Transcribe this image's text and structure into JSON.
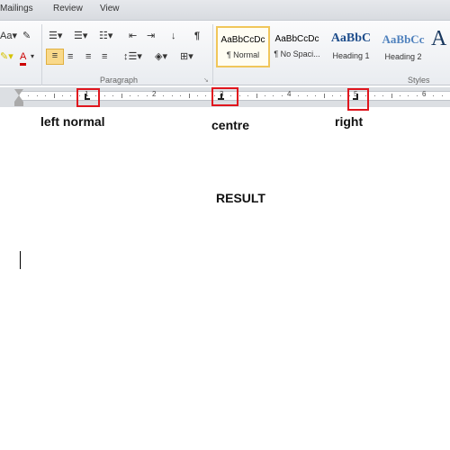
{
  "tabs": [
    "Mailings",
    "Review",
    "View"
  ],
  "ribbon": {
    "paragraph_group": "Paragraph",
    "styles_group": "Styles",
    "styles": [
      {
        "preview": "AaBbCcDc",
        "label": "¶ Normal",
        "selected": true
      },
      {
        "preview": "AaBbCcDc",
        "label": "¶ No Spaci...",
        "selected": false
      },
      {
        "preview": "AaBbC",
        "label": "Heading 1",
        "selected": false
      },
      {
        "preview": "AaBbCc",
        "label": "Heading 2",
        "selected": false
      },
      {
        "preview": "A",
        "label": "",
        "selected": false
      }
    ],
    "pilcrow": "¶"
  },
  "ruler": {
    "numbers": [
      "1",
      "2",
      "3",
      "4",
      "5",
      "6"
    ]
  },
  "annotations": {
    "left": "left normal",
    "centre": "centre",
    "right": "right",
    "highlight_color": "#e0161e"
  },
  "document": {
    "result": "RESULT"
  }
}
